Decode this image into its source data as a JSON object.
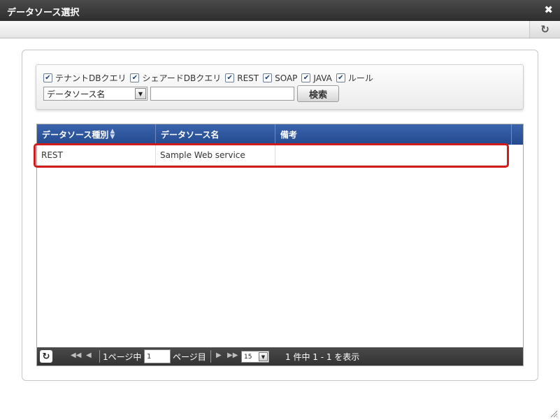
{
  "window": {
    "title": "データソース選択",
    "close_glyph": "✖",
    "refresh_glyph": "↻"
  },
  "search": {
    "checkboxes": [
      {
        "label": "テナントDBクエリ",
        "checked": true
      },
      {
        "label": "シェアードDBクエリ",
        "checked": true
      },
      {
        "label": "REST",
        "checked": true
      },
      {
        "label": "SOAP",
        "checked": true
      },
      {
        "label": "JAVA",
        "checked": true
      },
      {
        "label": "ルール",
        "checked": true
      }
    ],
    "field_select": "データソース名",
    "keyword_value": "",
    "button_label": "検索"
  },
  "grid": {
    "columns": [
      "データソース種別",
      "データソース名",
      "備考"
    ],
    "rows": [
      {
        "type": "REST",
        "name": "Sample Web service",
        "note": ""
      }
    ]
  },
  "pager": {
    "page_prefix": "1ページ中",
    "page_value": "1",
    "page_suffix": "ページ目",
    "page_size": "15",
    "summary": "1 件中 1 - 1 を表示"
  },
  "colors": {
    "header_blue": "#2b528f",
    "highlight_red": "#d01c1c",
    "titlebar_dark": "#333333"
  }
}
